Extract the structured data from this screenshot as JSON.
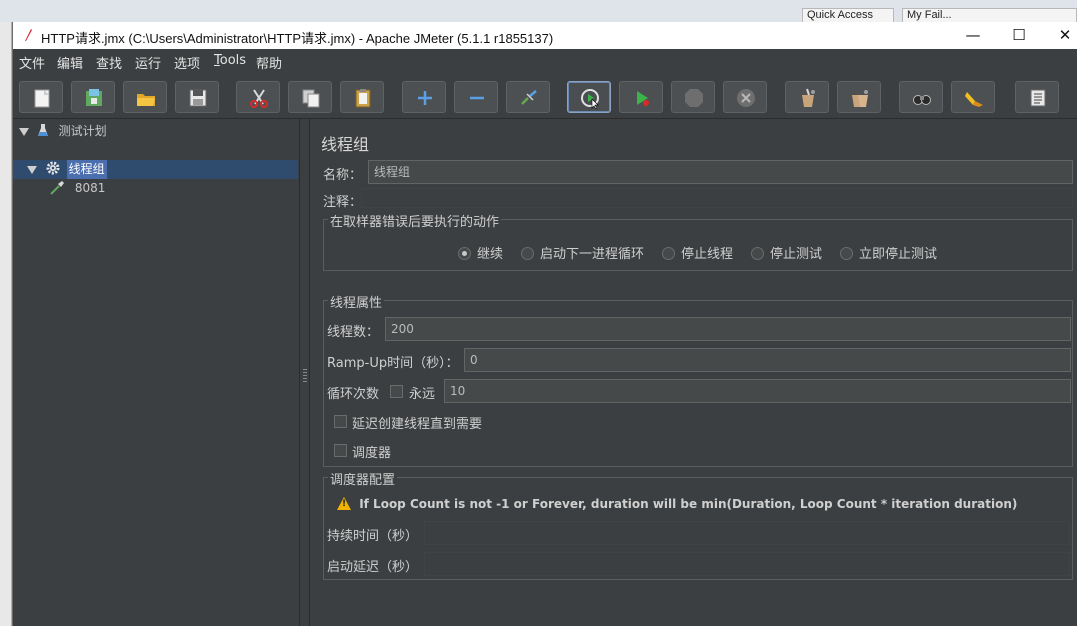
{
  "desktop": {
    "tab1": "Quick Access",
    "tab2": "My Fail..."
  },
  "window": {
    "title": "HTTP请求.jmx (C:\\Users\\Administrator\\HTTP请求.jmx) - Apache JMeter (5.1.1 r1855137)",
    "minimize": "—",
    "maximize": "☐",
    "close": "✕"
  },
  "menu": {
    "file": "文件",
    "edit": "编辑",
    "search": "查找",
    "run": "运行",
    "options": "选项",
    "tools_first": "T",
    "tools_rest": "ools",
    "help": "帮助"
  },
  "toolbar_icons": [
    "new-icon",
    "templates-icon",
    "open-icon",
    "save-icon",
    "cut-icon",
    "copy-icon",
    "paste-icon",
    "expand-icon",
    "collapse-icon",
    "toggle-icon",
    "start-icon",
    "start-no-pause-icon",
    "stop-icon",
    "shutdown-icon",
    "clear-icon",
    "clear-all-icon",
    "search-icon",
    "reset-search-icon",
    "function-helper-icon"
  ],
  "tree": {
    "test_plan": "测试计划",
    "thread_group": "线程组",
    "sampler": "8081"
  },
  "thread_group": {
    "title": "线程组",
    "name_label": "名称：",
    "name_value": "线程组",
    "comment_label": "注释：",
    "comment_value": "",
    "error_action_title": "在取样器错误后要执行的动作",
    "error_actions": [
      "继续",
      "启动下一进程循环",
      "停止线程",
      "停止测试",
      "立即停止测试"
    ],
    "error_action_selected": 0,
    "thread_props_title": "线程属性",
    "threads_label": "线程数：",
    "threads_value": "200",
    "rampup_label": "Ramp-Up时间（秒）：",
    "rampup_value": "0",
    "loop_label": "循环次数",
    "forever_label": "永远",
    "loop_value": "10",
    "delay_create_label": "延迟创建线程直到需要",
    "scheduler_label": "调度器",
    "scheduler_config_title": "调度器配置",
    "scheduler_warning": "If Loop Count is not -1 or Forever, duration will be min(Duration, Loop Count * iteration duration)",
    "duration_label": "持续时间（秒）",
    "duration_value": "",
    "startup_delay_label": "启动延迟（秒）",
    "startup_delay_value": ""
  },
  "colors": {
    "background": "#3c3f41",
    "selection": "#4b6eaf",
    "field": "#45494a",
    "warning": "#f0b400"
  }
}
